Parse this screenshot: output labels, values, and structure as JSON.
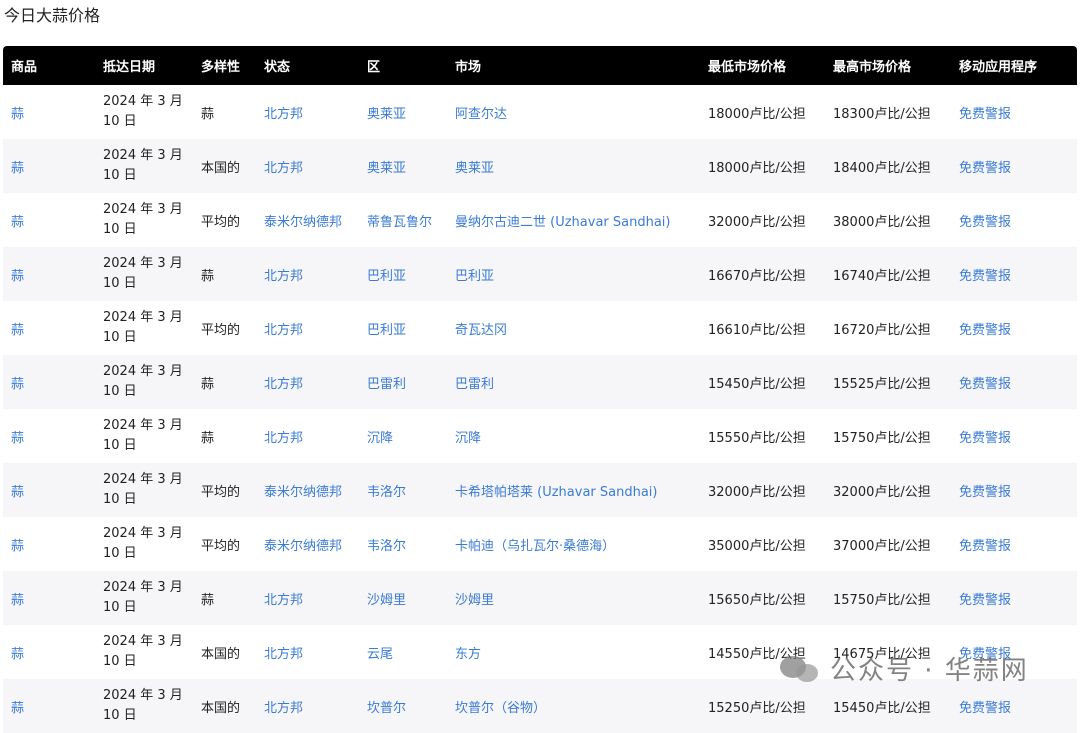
{
  "page_title": "今日大蒜价格",
  "table": {
    "headers": [
      "商品",
      "抵达日期",
      "多样性",
      "状态",
      "区",
      "市场",
      "最低市场价格",
      "最高市场价格",
      "移动应用程序"
    ],
    "rows": [
      [
        "蒜",
        "2024 年 3 月 10 日",
        "蒜",
        "北方邦",
        "奥莱亚",
        "阿查尔达",
        "18000卢比/公担",
        "18300卢比/公担",
        "免费警报"
      ],
      [
        "蒜",
        "2024 年 3 月 10 日",
        "本国的",
        "北方邦",
        "奥莱亚",
        "奥莱亚",
        "18000卢比/公担",
        "18400卢比/公担",
        "免费警报"
      ],
      [
        "蒜",
        "2024 年 3 月 10 日",
        "平均的",
        "泰米尔纳德邦",
        "蒂鲁瓦鲁尔",
        "曼纳尔古迪二世 (Uzhavar Sandhai)",
        "32000卢比/公担",
        "38000卢比/公担",
        "免费警报"
      ],
      [
        "蒜",
        "2024 年 3 月 10 日",
        "蒜",
        "北方邦",
        "巴利亚",
        "巴利亚",
        "16670卢比/公担",
        "16740卢比/公担",
        "免费警报"
      ],
      [
        "蒜",
        "2024 年 3 月 10 日",
        "平均的",
        "北方邦",
        "巴利亚",
        "奇瓦达冈",
        "16610卢比/公担",
        "16720卢比/公担",
        "免费警报"
      ],
      [
        "蒜",
        "2024 年 3 月 10 日",
        "蒜",
        "北方邦",
        "巴雷利",
        "巴雷利",
        "15450卢比/公担",
        "15525卢比/公担",
        "免费警报"
      ],
      [
        "蒜",
        "2024 年 3 月 10 日",
        "蒜",
        "北方邦",
        "沉降",
        "沉降",
        "15550卢比/公担",
        "15750卢比/公担",
        "免费警报"
      ],
      [
        "蒜",
        "2024 年 3 月 10 日",
        "平均的",
        "泰米尔纳德邦",
        "韦洛尔",
        "卡希塔帕塔莱 (Uzhavar Sandhai)",
        "32000卢比/公担",
        "32000卢比/公担",
        "免费警报"
      ],
      [
        "蒜",
        "2024 年 3 月 10 日",
        "平均的",
        "泰米尔纳德邦",
        "韦洛尔",
        "卡帕迪（乌扎瓦尔·桑德海）",
        "35000卢比/公担",
        "37000卢比/公担",
        "免费警报"
      ],
      [
        "蒜",
        "2024 年 3 月 10 日",
        "蒜",
        "北方邦",
        "沙姆里",
        "沙姆里",
        "15650卢比/公担",
        "15750卢比/公担",
        "免费警报"
      ],
      [
        "蒜",
        "2024 年 3 月 10 日",
        "本国的",
        "北方邦",
        "云尾",
        "东方",
        "14550卢比/公担",
        "14675卢比/公担",
        "免费警报"
      ],
      [
        "蒜",
        "2024 年 3 月 10 日",
        "本国的",
        "北方邦",
        "坎普尔",
        "坎普尔（谷物）",
        "15250卢比/公担",
        "15450卢比/公担",
        "免费警报"
      ]
    ]
  },
  "watermark": {
    "text": "公众号 · 华蒜网",
    "icon": "wechat-icon"
  },
  "colors": {
    "header_bg": "#000000",
    "header_text": "#ffffff",
    "link": "#3a7bd5",
    "row_alt": "#f6f6f9"
  }
}
